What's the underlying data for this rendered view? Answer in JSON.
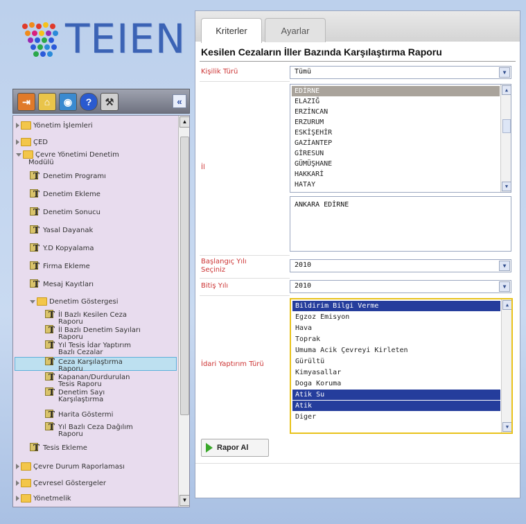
{
  "logo": {
    "text": "TEIEN"
  },
  "toolbar": {
    "buttons": [
      "exit-icon",
      "home-icon",
      "globe-icon",
      "help-icon",
      "tools-icon"
    ],
    "collapse_label": "«"
  },
  "tree": {
    "items": [
      {
        "label": "Yönetim İşlemleri"
      },
      {
        "label": "ÇED"
      },
      {
        "label": "Çevre Yönetimi Denetim",
        "label2": "Modülü"
      },
      {
        "label": "Denetim Programı"
      },
      {
        "label": "Denetim Ekleme"
      },
      {
        "label": "Denetim Sonucu"
      },
      {
        "label": "Yasal Dayanak"
      },
      {
        "label": "Y.D Kopyalama"
      },
      {
        "label": "Firma Ekleme"
      },
      {
        "label": "Mesaj Kayıtları"
      },
      {
        "label": "Denetim Göstergesi"
      },
      {
        "label": "İl Bazlı Kesilen Ceza",
        "label2": "Raporu"
      },
      {
        "label": "İl Bazlı Denetim Sayıları",
        "label2": "Raporu"
      },
      {
        "label": "Yıl Tesis İdar Yaptırım",
        "label2": "Bazlı Cezalar"
      },
      {
        "label": "Ceza Karşılaştırma",
        "label2": "Raporu"
      },
      {
        "label": "Kapanan/Durdurulan",
        "label2": "Tesis Raporu"
      },
      {
        "label": "Denetim Sayı",
        "label2": "Karşılaştırma"
      },
      {
        "label": "Harita Göstermi"
      },
      {
        "label": "Yıl Bazlı Ceza Dağılım",
        "label2": "Raporu"
      },
      {
        "label": "Tesis Ekleme"
      },
      {
        "label": "Çevre Durum Raporlaması"
      },
      {
        "label": "Çevresel Göstergeler"
      },
      {
        "label": "Yönetmelik"
      }
    ]
  },
  "tabs": {
    "active": "Kriterler",
    "inactive": "Ayarlar"
  },
  "page_title": "Kesilen Cezaların İller Bazında Karşılaştırma Raporu",
  "form": {
    "kisilik_label": "Kişilik Türü",
    "kisilik_value": "Tümü",
    "il_label": "İl",
    "il_options": [
      "EDİRNE",
      "ELAZIĞ",
      "ERZİNCAN",
      "ERZURUM",
      "ESKİŞEHİR",
      "GAZİANTEP",
      "GİRESUN",
      "GÜMÜŞHANE",
      "HAKKARİ",
      "HATAY"
    ],
    "il_selected_text": "ANKARA EDİRNE",
    "baslangic_label": "Başlangıç Yılı",
    "baslangic_label2": "Seçiniz",
    "baslangic_value": "2010",
    "bitis_label": "Bitiş Yılı",
    "bitis_value": "2010",
    "idari_label": "İdari Yaptırım Türü",
    "idari_options": [
      "Bildirim Bilgi Verme",
      "Egzoz Emisyon",
      "Hava",
      "Toprak",
      "Umuma Acik Çevreyi Kirleten",
      "Gürültü",
      "Kimyasallar",
      "Doga Koruma",
      "Atik Su",
      "Atik",
      "Diger"
    ],
    "idari_selected": [
      "Bildirim Bilgi Verme",
      "Atik Su",
      "Atik"
    ]
  },
  "report_button": {
    "label": "Rapor Al"
  }
}
